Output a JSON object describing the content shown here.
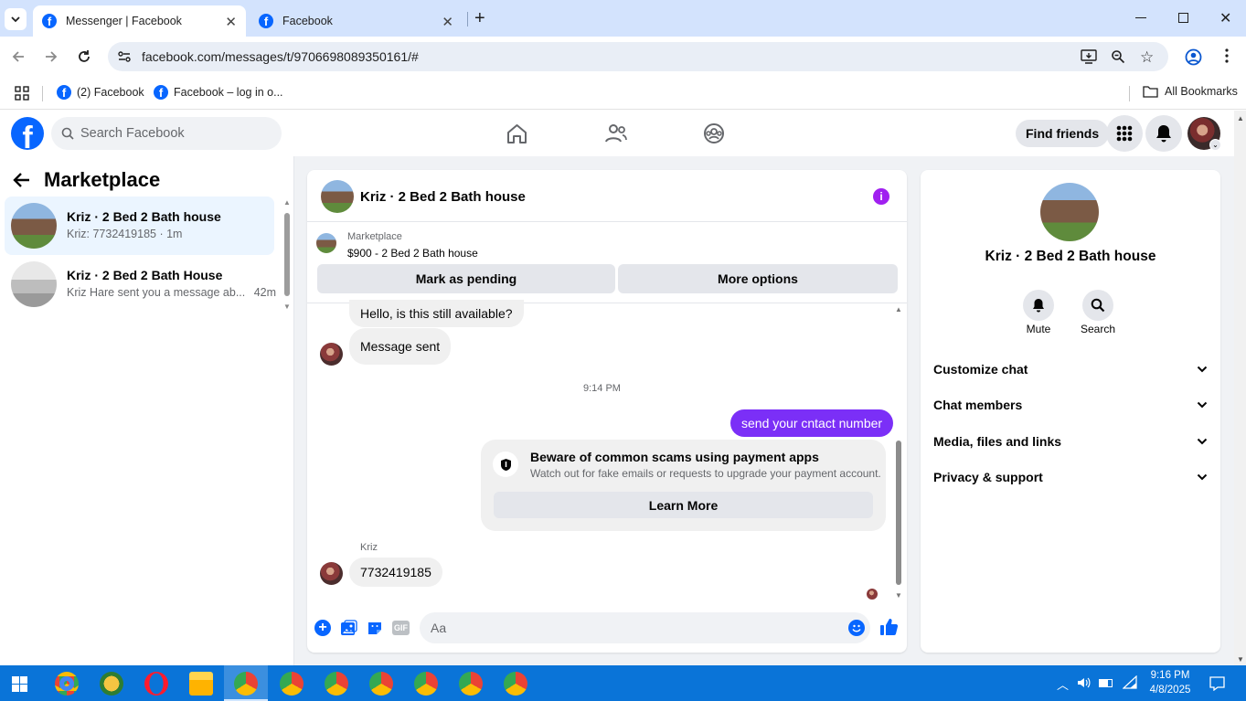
{
  "browser": {
    "tabs": [
      {
        "title": "Messenger | Facebook",
        "active": true
      },
      {
        "title": "Facebook",
        "active": false
      }
    ],
    "url": "facebook.com/messages/t/9706698089350161/#",
    "bookmarks": [
      "(2) Facebook",
      "Facebook – log in o..."
    ],
    "all_bookmarks": "All Bookmarks"
  },
  "fb": {
    "logo": "f",
    "search_placeholder": "Search Facebook",
    "find_friends": "Find friends"
  },
  "sidebar": {
    "title": "Marketplace",
    "conversations": [
      {
        "title": "Kriz · 2 Bed 2 Bath house",
        "preview": "Kriz: 7732419185 · 1m",
        "time": ""
      },
      {
        "title": "Kriz · 2 Bed 2 Bath House",
        "preview": "Kriz Hare sent you a message ab...",
        "time": "42m"
      }
    ]
  },
  "chat": {
    "title": "Kriz · 2 Bed 2 Bath house",
    "listing_source": "Marketplace",
    "listing": "$900 - 2 Bed 2 Bath house",
    "mark_pending": "Mark as pending",
    "more_options": "More options",
    "messages": {
      "m1": "Hello, is this still available?",
      "m2": "Message sent",
      "time": "9:14 PM",
      "m3": "send your cntact number",
      "sender": "Kriz",
      "m4": "7732419185"
    },
    "scam_card": {
      "title": "Beware of common scams using payment apps",
      "body": "Watch out for fake emails or requests to upgrade your payment account.",
      "button": "Learn More"
    },
    "composer_placeholder": "Aa",
    "gif_label": "GIF"
  },
  "info_panel": {
    "name": "Kriz · 2 Bed 2 Bath house",
    "mute": "Mute",
    "search": "Search",
    "sections": [
      "Customize chat",
      "Chat members",
      "Media, files and links",
      "Privacy & support"
    ]
  },
  "taskbar": {
    "time": "9:16 PM",
    "date": "4/8/2025"
  },
  "colors": {
    "fb_blue": "#0866ff",
    "messenger_purple": "#7c3aed",
    "taskbar": "#0a74d8"
  }
}
